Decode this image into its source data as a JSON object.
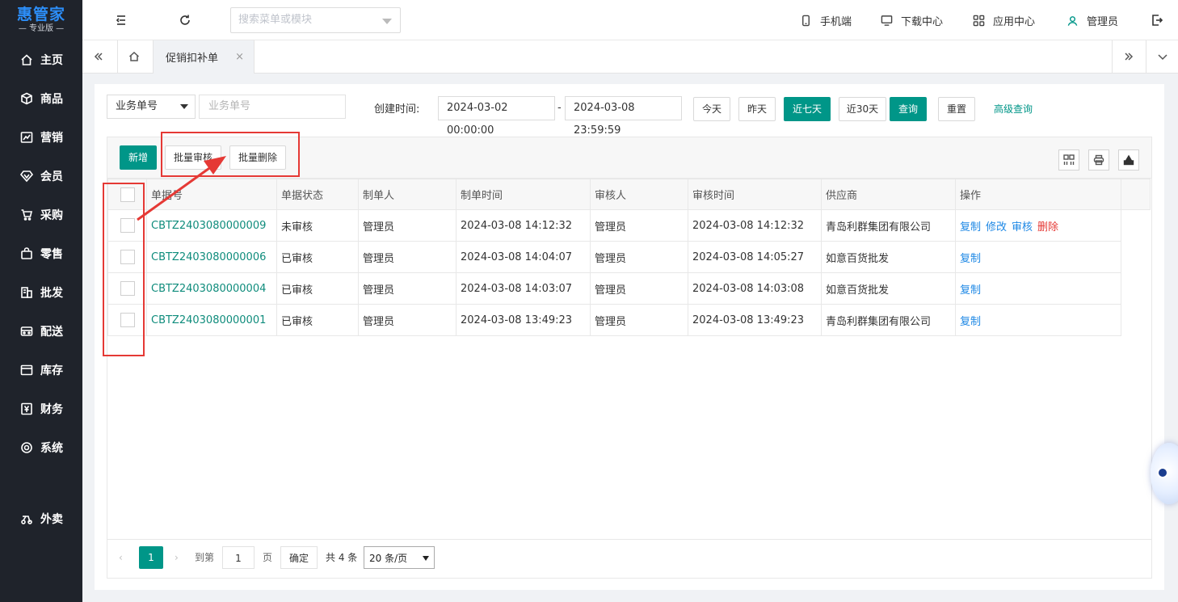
{
  "brand": {
    "name": "惠管家",
    "edition": "— 专业版 —"
  },
  "sidebar": {
    "items": [
      {
        "label": "主页",
        "icon": "home-icon"
      },
      {
        "label": "商品",
        "icon": "box-icon"
      },
      {
        "label": "营销",
        "icon": "chart-icon"
      },
      {
        "label": "会员",
        "icon": "diamond-icon"
      },
      {
        "label": "采购",
        "icon": "cart-icon"
      },
      {
        "label": "零售",
        "icon": "bag-icon"
      },
      {
        "label": "批发",
        "icon": "building-icon"
      },
      {
        "label": "配送",
        "icon": "truck-icon"
      },
      {
        "label": "库存",
        "icon": "archive-icon"
      },
      {
        "label": "财务",
        "icon": "yen-icon"
      },
      {
        "label": "系统",
        "icon": "gear-icon"
      },
      {
        "label": "外卖",
        "icon": "scooter-icon"
      }
    ]
  },
  "header": {
    "search_placeholder": "搜索菜单或模块",
    "mobile": "手机端",
    "download": "下载中心",
    "apps": "应用中心",
    "user": "管理员"
  },
  "tabs": {
    "active": "促销扣补单",
    "close": "×"
  },
  "filter": {
    "type_select": "业务单号",
    "number_placeholder": "业务单号",
    "created_label": "创建时间:",
    "date_from": "2024-03-02 00:00:00",
    "date_sep": "-",
    "date_to": "2024-03-08 23:59:59",
    "today": "今天",
    "yesterday": "昨天",
    "last7": "近七天",
    "last30": "近30天",
    "query": "查询",
    "reset": "重置",
    "advanced": "高级查询"
  },
  "toolbar": {
    "add": "新增",
    "batch_audit": "批量审核",
    "batch_delete": "批量删除"
  },
  "table": {
    "columns": [
      "单据号",
      "单据状态",
      "制单人",
      "制单时间",
      "审核人",
      "审核时间",
      "供应商",
      "操作"
    ],
    "rows": [
      {
        "code": "CBTZ2403080000009",
        "status": "未审核",
        "maker": "管理员",
        "make_time": "2024-03-08 14:12:32",
        "auditor": "管理员",
        "audit_time": "2024-03-08 14:12:32",
        "supplier": "青岛利群集团有限公司",
        "ops": [
          "复制",
          "修改",
          "审核",
          "删除"
        ]
      },
      {
        "code": "CBTZ2403080000006",
        "status": "已审核",
        "maker": "管理员",
        "make_time": "2024-03-08 14:04:07",
        "auditor": "管理员",
        "audit_time": "2024-03-08 14:05:27",
        "supplier": "如意百货批发",
        "ops": [
          "复制"
        ]
      },
      {
        "code": "CBTZ2403080000004",
        "status": "已审核",
        "maker": "管理员",
        "make_time": "2024-03-08 14:03:07",
        "auditor": "管理员",
        "audit_time": "2024-03-08 14:03:08",
        "supplier": "如意百货批发",
        "ops": [
          "复制"
        ]
      },
      {
        "code": "CBTZ2403080000001",
        "status": "已审核",
        "maker": "管理员",
        "make_time": "2024-03-08 13:49:23",
        "auditor": "管理员",
        "audit_time": "2024-03-08 13:49:23",
        "supplier": "青岛利群集团有限公司",
        "ops": [
          "复制"
        ]
      }
    ]
  },
  "pager": {
    "current": "1",
    "goto_label": "到第",
    "goto_value": "1",
    "page_unit": "页",
    "confirm": "确定",
    "total": "共 4 条",
    "page_size": "20 条/页"
  },
  "colors": {
    "primary": "#009688",
    "sidebar_bg": "#1f232b",
    "logo": "#2c8ef8",
    "annotation": "#e53935"
  }
}
